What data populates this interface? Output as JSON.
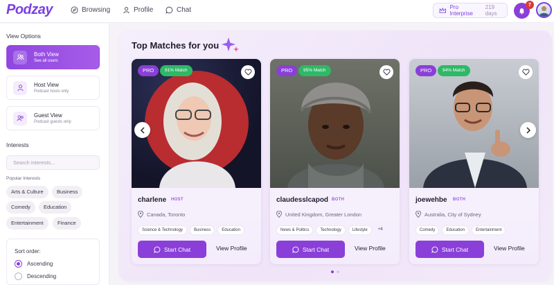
{
  "header": {
    "logo": "Podzay",
    "nav": [
      {
        "label": "Browsing",
        "icon": "compass-icon"
      },
      {
        "label": "Profile",
        "icon": "user-icon"
      },
      {
        "label": "Chat",
        "icon": "chat-icon"
      }
    ],
    "plan_label": "Pro Interprise",
    "plan_days": "219 days",
    "notification_count": "7"
  },
  "sidebar": {
    "view_options_heading": "View Options",
    "views": [
      {
        "title": "Both View",
        "subtitle": "See all users",
        "active": true
      },
      {
        "title": "Host View",
        "subtitle": "Podcast hosts only",
        "active": false
      },
      {
        "title": "Guest View",
        "subtitle": "Podcast guests only",
        "active": false
      }
    ],
    "interests_heading": "Interests",
    "search_placeholder": "Search interests...",
    "popular_heading": "Popular Interests",
    "popular": [
      "Arts & Culture",
      "Business",
      "Comedy",
      "Education",
      "Entertainment",
      "Finance"
    ],
    "sort_heading": "Sort order:",
    "sort_options": [
      {
        "label": "Ascending",
        "selected": true
      },
      {
        "label": "Descending",
        "selected": false
      }
    ]
  },
  "main": {
    "title": "Top Matches for you",
    "cards": [
      {
        "pro_label": "PRO",
        "match": "91% Match",
        "name": "charlene",
        "role": "HOST",
        "location": "Canada, Toronto",
        "tags": [
          "Science & Technology",
          "Business",
          "Education"
        ],
        "more": "",
        "chat_label": "Start Chat",
        "view_label": "View Profile"
      },
      {
        "pro_label": "PRO",
        "match": "95% Match",
        "name": "claudesslcapod",
        "role": "BOTH",
        "location": "United Kingdom, Greater London",
        "tags": [
          "News & Politics",
          "Technology",
          "Lifestyle"
        ],
        "more": "+4",
        "chat_label": "Start Chat",
        "view_label": "View Profile"
      },
      {
        "pro_label": "PRO",
        "match": "94% Match",
        "name": "joewehbe",
        "role": "BOTH",
        "location": "Australia, City of Sydney",
        "tags": [
          "Comedy",
          "Education",
          "Entertainment"
        ],
        "more": "",
        "chat_label": "Start Chat",
        "view_label": "View Profile"
      }
    ],
    "pagination_pages": 2,
    "pagination_current": 1
  },
  "colors": {
    "accent": "#8a3fd8",
    "match_green": "#2fb866",
    "badge_red": "#d93a3a"
  }
}
